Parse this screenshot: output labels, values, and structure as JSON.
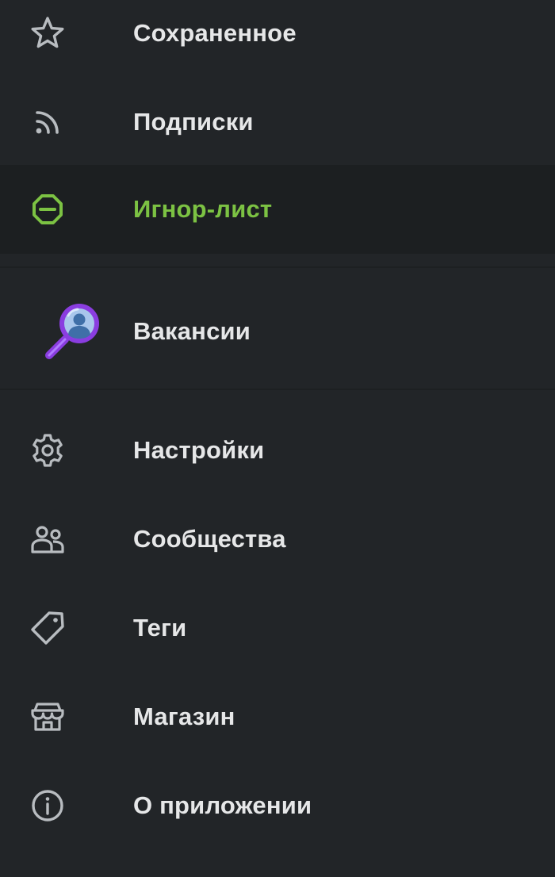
{
  "menu": {
    "items": [
      {
        "label": "Сохраненное",
        "icon": "star-icon"
      },
      {
        "label": "Подписки",
        "icon": "rss-icon"
      },
      {
        "label": "Игнор-лист",
        "icon": "block-icon",
        "active": true
      },
      {
        "label": "Вакансии",
        "icon": "job-search-icon"
      },
      {
        "label": "Настройки",
        "icon": "gear-icon"
      },
      {
        "label": "Сообщества",
        "icon": "people-icon"
      },
      {
        "label": "Теги",
        "icon": "tag-icon"
      },
      {
        "label": "Магазин",
        "icon": "shop-icon"
      },
      {
        "label": "О приложении",
        "icon": "info-icon"
      }
    ]
  },
  "colors": {
    "background": "#222528",
    "active_background": "#1c1f21",
    "text": "#e6e7e8",
    "accent": "#7cc243",
    "icon": "#b8bcc0",
    "magnifier": "#8a3de0"
  }
}
